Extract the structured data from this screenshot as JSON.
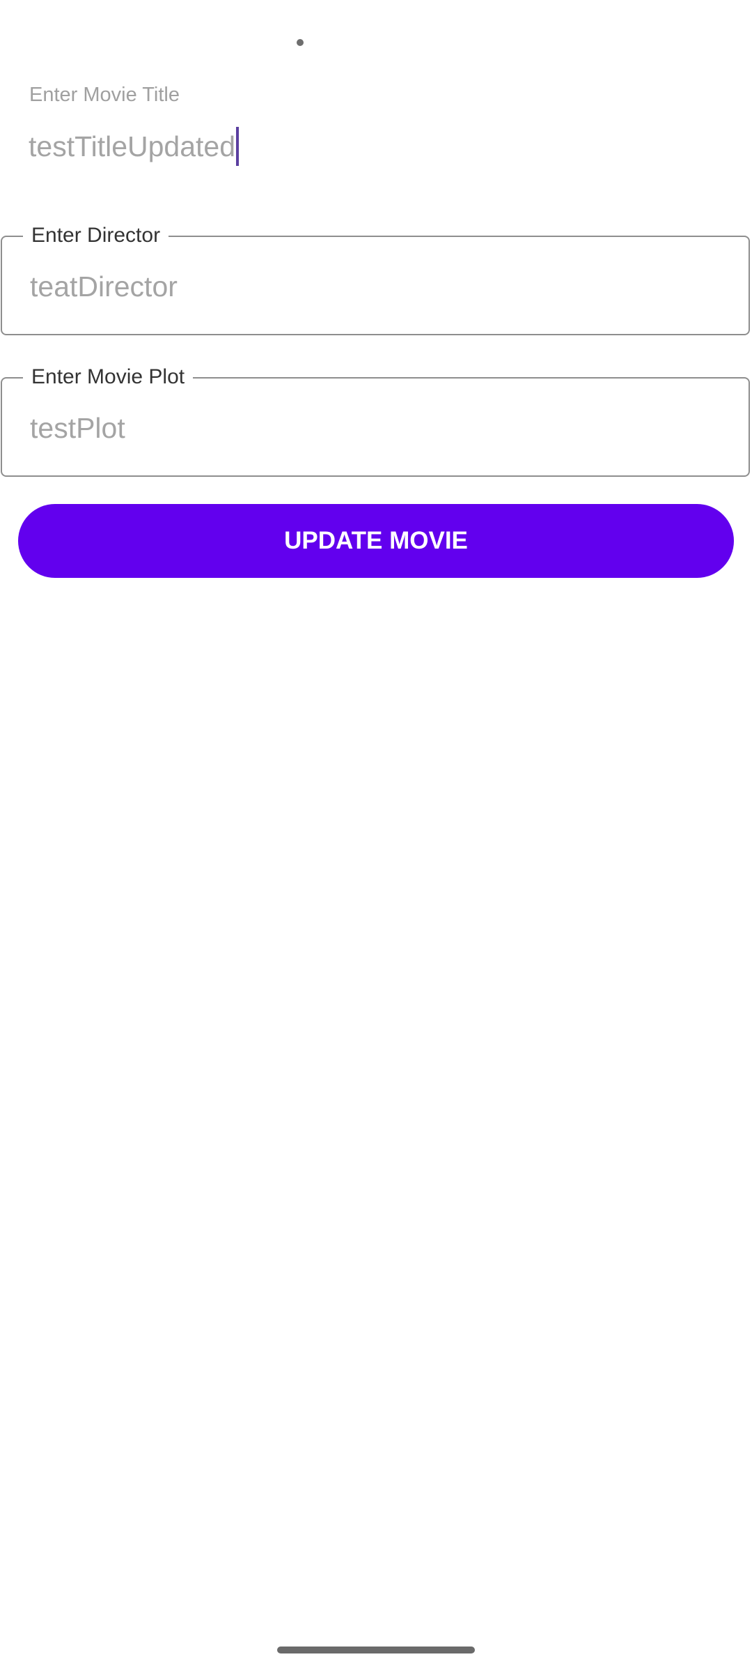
{
  "form": {
    "title": {
      "label": "Enter Movie Title",
      "value": "testTitleUpdated"
    },
    "director": {
      "label": "Enter Director",
      "value": "teatDirector"
    },
    "plot": {
      "label": "Enter Movie Plot",
      "value": "testPlot"
    },
    "submit_label": "UPDATE MOVIE"
  },
  "colors": {
    "accent": "#6200EE",
    "cursor": "#5B3FA0"
  }
}
